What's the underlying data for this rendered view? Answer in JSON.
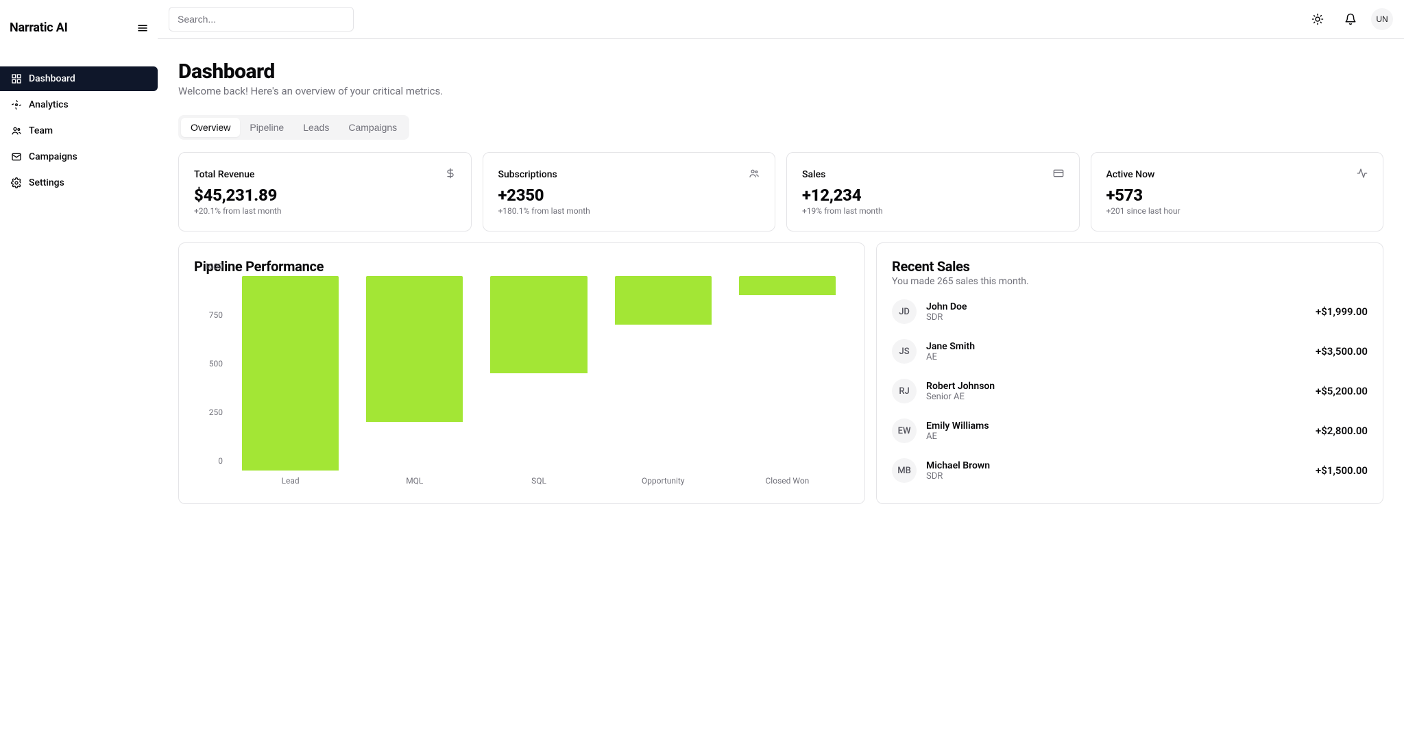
{
  "brand": "Narratic AI",
  "search": {
    "placeholder": "Search..."
  },
  "avatar_initials": "UN",
  "sidebar": {
    "items": [
      {
        "label": "Dashboard"
      },
      {
        "label": "Analytics"
      },
      {
        "label": "Team"
      },
      {
        "label": "Campaigns"
      },
      {
        "label": "Settings"
      }
    ]
  },
  "page": {
    "title": "Dashboard",
    "subtitle": "Welcome back! Here's an overview of your critical metrics."
  },
  "tabs": [
    {
      "label": "Overview"
    },
    {
      "label": "Pipeline"
    },
    {
      "label": "Leads"
    },
    {
      "label": "Campaigns"
    }
  ],
  "stats": [
    {
      "label": "Total Revenue",
      "value": "$45,231.89",
      "delta": "+20.1% from last month"
    },
    {
      "label": "Subscriptions",
      "value": "+2350",
      "delta": "+180.1% from last month"
    },
    {
      "label": "Sales",
      "value": "+12,234",
      "delta": "+19% from last month"
    },
    {
      "label": "Active Now",
      "value": "+573",
      "delta": "+201 since last hour"
    }
  ],
  "pipeline": {
    "title": "Pipeline Performance"
  },
  "recent_sales": {
    "title": "Recent Sales",
    "subtitle": "You made 265 sales this month.",
    "rows": [
      {
        "initials": "JD",
        "name": "John Doe",
        "role": "SDR",
        "amount": "+$1,999.00"
      },
      {
        "initials": "JS",
        "name": "Jane Smith",
        "role": "AE",
        "amount": "+$3,500.00"
      },
      {
        "initials": "RJ",
        "name": "Robert Johnson",
        "role": "Senior AE",
        "amount": "+$5,200.00"
      },
      {
        "initials": "EW",
        "name": "Emily Williams",
        "role": "AE",
        "amount": "+$2,800.00"
      },
      {
        "initials": "MB",
        "name": "Michael Brown",
        "role": "SDR",
        "amount": "+$1,500.00"
      }
    ]
  },
  "chart_data": {
    "type": "bar",
    "title": "Pipeline Performance",
    "categories": [
      "Lead",
      "MQL",
      "SQL",
      "Opportunity",
      "Closed Won"
    ],
    "values": [
      1000,
      750,
      500,
      250,
      100
    ],
    "ylim": [
      0,
      1000
    ],
    "yticks": [
      0,
      250,
      500,
      750,
      1000
    ],
    "xlabel": "",
    "ylabel": ""
  }
}
